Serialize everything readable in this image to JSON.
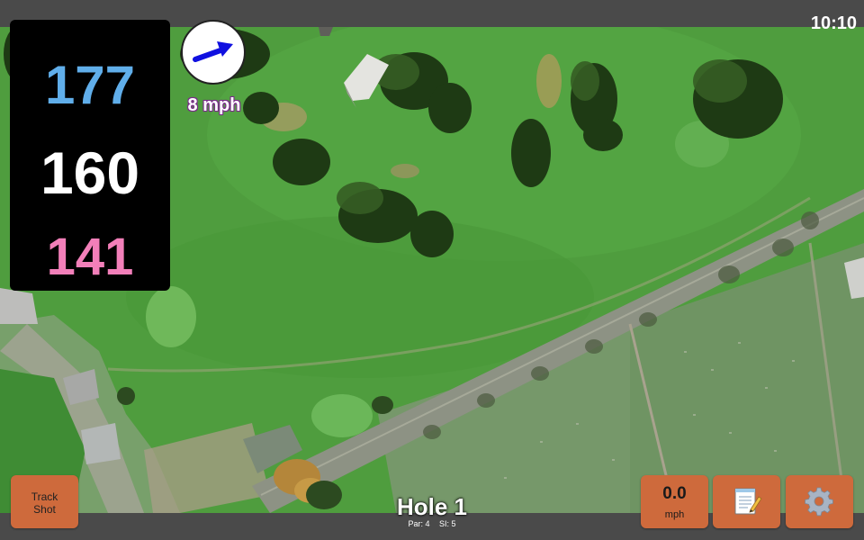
{
  "status_bar": {
    "time": "10:10"
  },
  "yardages": {
    "back": "177",
    "center": "160",
    "front": "141"
  },
  "colors": {
    "back": "#60aeea",
    "center": "#ffffff",
    "front": "#f27fb9",
    "button": "#ce6a3c",
    "wind_arrow": "#1010e0"
  },
  "wind": {
    "speed_label": "8 mph",
    "direction_icon": "arrow-icon"
  },
  "buttons": {
    "track_shot_line1": "Track",
    "track_shot_line2": "Shot",
    "speed_value": "0.0",
    "speed_unit": "mph",
    "notes_icon": "notepad-icon",
    "settings_icon": "gear-icon"
  },
  "hole": {
    "title": "Hole 1",
    "par_label": "Par: 4",
    "si_label": "SI: 5"
  },
  "map": {
    "type": "satellite-view"
  }
}
